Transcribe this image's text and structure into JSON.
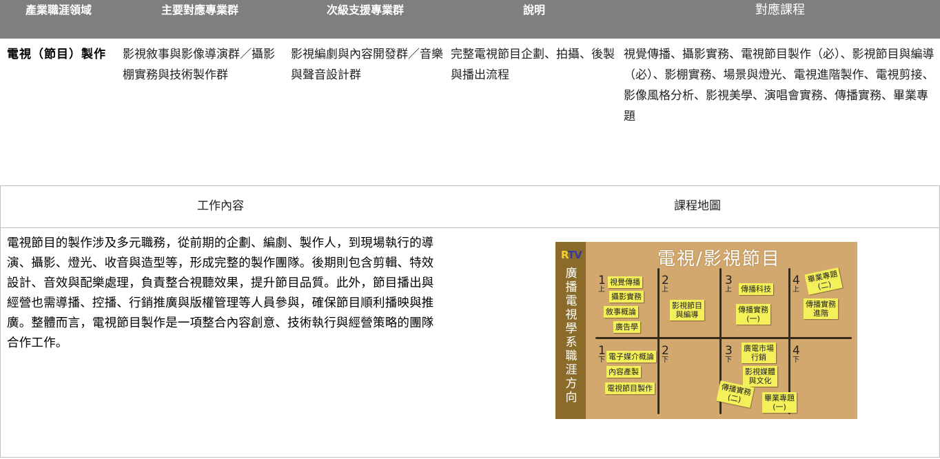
{
  "table": {
    "headers": [
      "產業職涯領域",
      "主要對應專業群",
      "次級支援專業群",
      "說明",
      "對應課程"
    ],
    "row": {
      "field": "電視（節目）製作",
      "main_group": "影視敘事與影像導演群／攝影棚實務與技術製作群",
      "support_group": "影視編劇與內容開發群／音樂與聲音設計群",
      "description": "完整電視節目企劃、拍攝、後製與播出流程",
      "courses": "視覺傳播、攝影實務、電視節目製作（必）、影視節目與編導（必）、影棚實務、場景與燈光、電視進階製作、電視剪接、影像風格分析、影視美學、演唱會實務、傳播實務、畢業專題"
    }
  },
  "lower": {
    "left_heading": "工作內容",
    "right_heading": "課程地圖",
    "work_content": "電視節目的製作涉及多元職務，從前期的企劃、編劇、製作人，到現場執行的導演、攝影、燈光、收音與造型等，形成完整的製作團隊。後期則包含剪輯、特效設計、音效與配樂處理，負責整合視聽效果，提升節目品質。此外，節目播出與經營也需導播、控播、行銷推廣與版權管理等人員參與，確保節目順利播映與推廣。整體而言，電視節目製作是一項整合內容創意、技術執行與經營策略的團隊合作工作。"
  },
  "course_map": {
    "logo_left": "R",
    "logo_right": "TV",
    "side_title": "廣播電視學系職涯方向",
    "title": "電視/影視節目",
    "upper_label": "上",
    "lower_label": "下",
    "year_numbers": [
      "1",
      "2",
      "3",
      "4"
    ],
    "notes": {
      "y1_up_a": "視覺傳播",
      "y1_up_b": "攝影實務",
      "y1_up_c": "敘事概論",
      "y1_up_d": "廣告學",
      "y2_up_a": "影視節目",
      "y2_up_a2": "與編導",
      "y3_up_a": "傳播科技",
      "y3_up_b": "傳播實務",
      "y3_up_b2": "(一)",
      "y4_up_a": "畢業專題",
      "y4_up_a2": "(二)",
      "y4_up_b": "傳播實務",
      "y4_up_b2": "進階",
      "y1_dn_a": "電子媒介概論",
      "y1_dn_b": "內容產製",
      "y1_dn_c": "電視節目製作",
      "y3_dn_a": "廣電市場",
      "y3_dn_a2": "行銷",
      "y3_dn_b": "影視媒體",
      "y3_dn_b2": "與文化",
      "y3_dn_c": "傳播實務",
      "y3_dn_c2": "(二)",
      "y4_dn_a": "畢業專題",
      "y4_dn_a2": "(一)"
    }
  }
}
